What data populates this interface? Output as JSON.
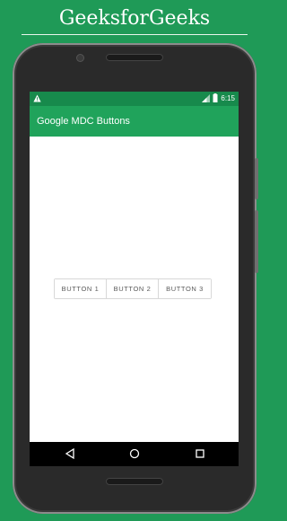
{
  "banner": {
    "title": "GeeksforGeeks"
  },
  "status_bar": {
    "time": "6:15",
    "icons": [
      "warning-icon",
      "signal-icon",
      "battery-icon"
    ]
  },
  "app_bar": {
    "title": "Google MDC Buttons"
  },
  "buttons": [
    {
      "label": "BUTTON 1"
    },
    {
      "label": "BUTTON 2"
    },
    {
      "label": "BUTTON 3"
    }
  ],
  "nav_bar": {
    "icons": [
      "back-icon",
      "home-icon",
      "recents-icon"
    ]
  },
  "colors": {
    "background": "#1f9a57",
    "status_bar": "#178a4c",
    "app_bar": "#20a35b",
    "button_text": "#5a5a5a",
    "button_border": "#d8d8d8"
  }
}
